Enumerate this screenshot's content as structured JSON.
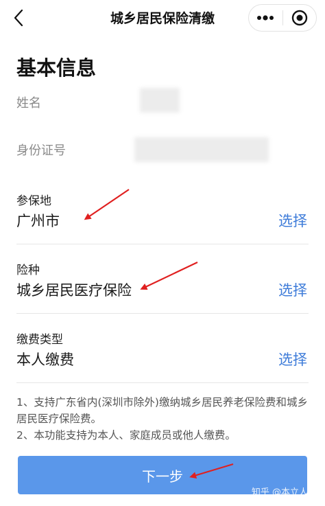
{
  "header": {
    "title": "城乡居民保险清缴",
    "back_icon": "chevron-left-icon",
    "more_icon": "more-dots-icon",
    "close_icon": "target-close-icon"
  },
  "section": {
    "title": "基本信息"
  },
  "basic_info": {
    "name_label": "姓名",
    "id_label": "身份证号"
  },
  "fields": [
    {
      "label": "参保地",
      "value": "广州市",
      "action": "选择"
    },
    {
      "label": "险种",
      "value": "城乡居民医疗保险",
      "action": "选择"
    },
    {
      "label": "缴费类型",
      "value": "本人缴费",
      "action": "选择"
    }
  ],
  "notes": {
    "line1": "1、支持广东省内(深圳市除外)缴纳城乡居民养老保险费和城乡居民医疗保险费。",
    "line2": "2、本功能支持为本人、家庭成员或他人缴费。"
  },
  "next_button": "下一步",
  "watermark": "知乎 @本立人力",
  "colors": {
    "accent": "#3d7bd9",
    "button": "#5a97ea",
    "arrow": "#e02020"
  }
}
